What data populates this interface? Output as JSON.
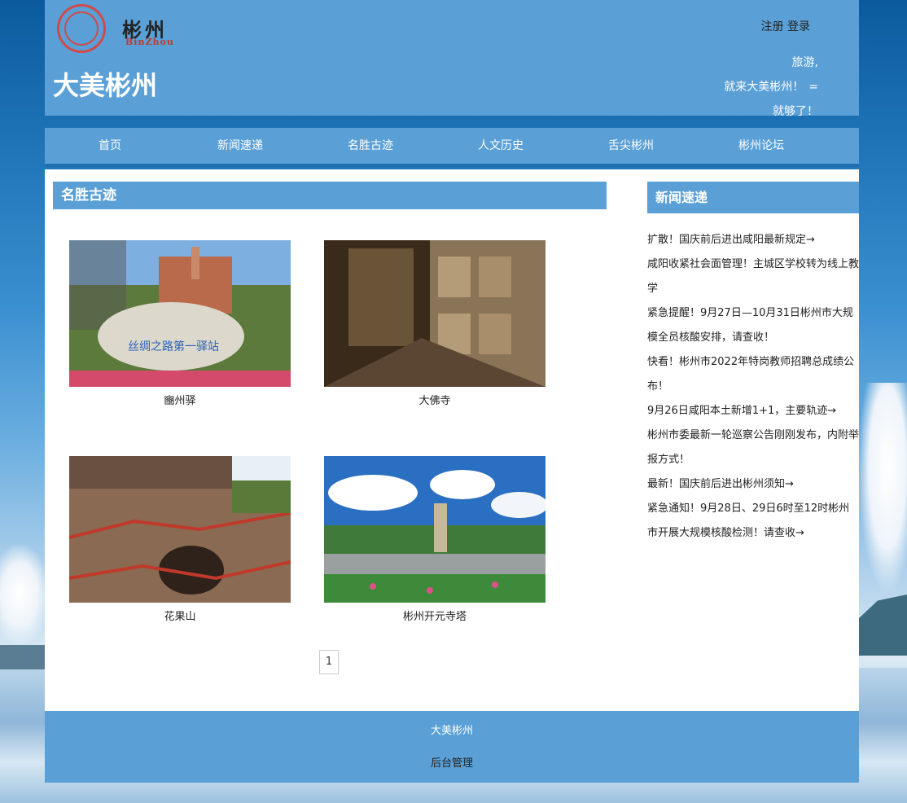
{
  "header": {
    "logo_text": "彬州",
    "logo_en": "BinZhou",
    "site_title": "大美彬州",
    "register_label": "注册",
    "login_label": "登录",
    "slogan_line1": "旅游,",
    "slogan_line2": "就来大美彬州！",
    "slogan_line3": "就够了！",
    "menu_glyph": "="
  },
  "nav": {
    "items": [
      {
        "label": "首页"
      },
      {
        "label": "新闻速递"
      },
      {
        "label": "名胜古迹"
      },
      {
        "label": "人文历史"
      },
      {
        "label": "舌尖彬州"
      },
      {
        "label": "彬州论坛"
      }
    ]
  },
  "main": {
    "section_title": "名胜古迹",
    "cards": [
      {
        "caption": "豳州驿"
      },
      {
        "caption": "大佛寺"
      },
      {
        "caption": "花果山"
      },
      {
        "caption": "彬州开元寺塔"
      }
    ],
    "pagination": {
      "current": "1"
    }
  },
  "sidebar": {
    "title": "新闻速递",
    "news": [
      {
        "text": "扩散！国庆前后进出咸阳最新规定→"
      },
      {
        "text": "咸阳收紧社会面管理！主城区学校转为线上教学"
      },
      {
        "text": "紧急提醒！9月27日—10月31日彬州市大规模全员核酸安排，请查收！"
      },
      {
        "text": "快看！彬州市2022年特岗教师招聘总成绩公布！"
      },
      {
        "text": "9月26日咸阳本土新增1+1，主要轨迹→"
      },
      {
        "text": "彬州市委最新一轮巡察公告刚刚发布，内附举报方式！"
      },
      {
        "text": "最新！国庆前后进出彬州须知→"
      },
      {
        "text": "紧急通知！9月28日、29日6时至12时彬州市开展大规模核酸检测！请查收→"
      }
    ]
  },
  "footer": {
    "title": "大美彬州",
    "admin_label": "后台管理"
  }
}
